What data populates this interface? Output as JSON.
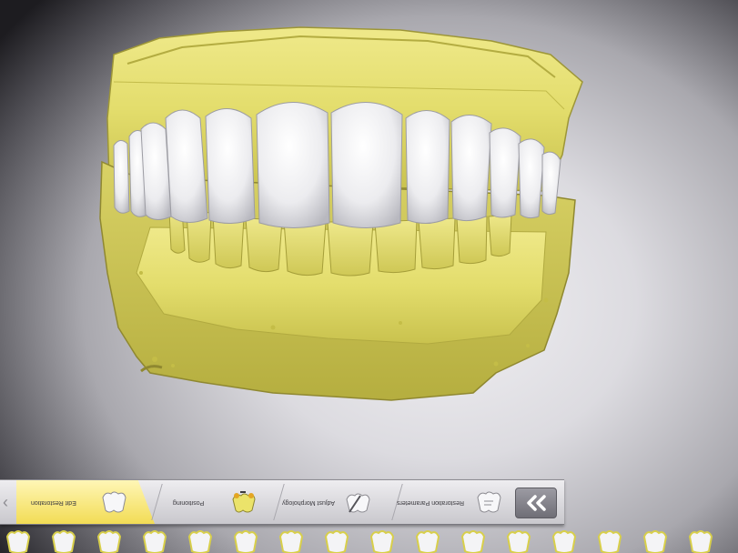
{
  "workflow": {
    "steps": [
      {
        "label": "Edit Restoration",
        "active": true
      },
      {
        "label": "Positioning",
        "active": false
      },
      {
        "label": "Adjust Morphology",
        "active": false
      },
      {
        "label": "Restoration Parameters",
        "active": false
      }
    ],
    "next_icon": "double-chevron-icon",
    "prev_icon": "chevron-left-icon"
  },
  "tooth_library": {
    "count": 16
  },
  "colors": {
    "model": "#e6e07a",
    "teeth": "#f2f2f4",
    "active_step": "#f2dc55"
  }
}
